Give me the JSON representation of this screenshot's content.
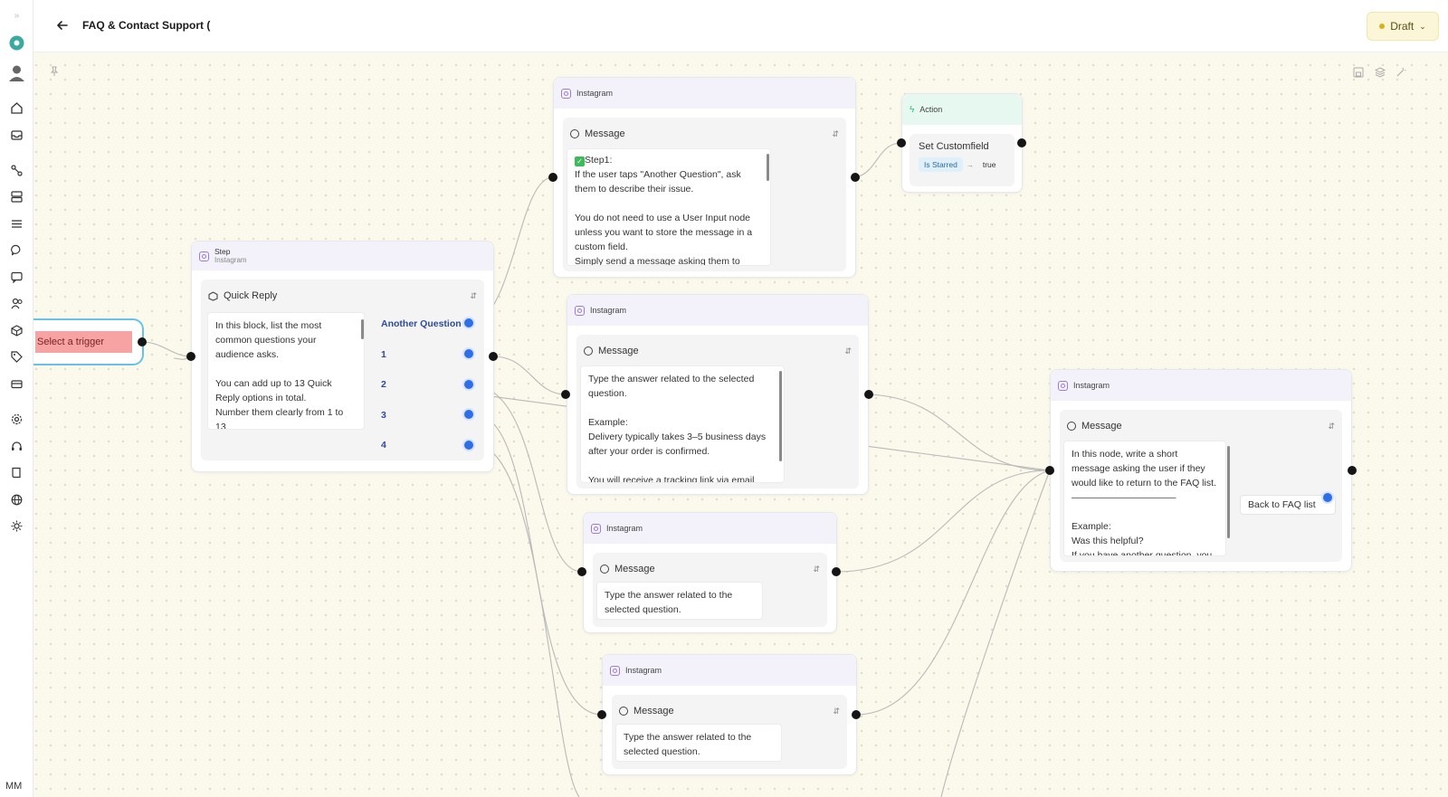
{
  "header": {
    "title": "FAQ & Contact Support (",
    "status": "Draft"
  },
  "sidebar": {
    "user_initials": "MM",
    "icons": [
      "collapse-icon",
      "workspace-icon",
      "profile-icon",
      "home-icon",
      "inbox-icon",
      "flows-icon",
      "templates-icon",
      "list-icon",
      "chat-icon",
      "comments-icon",
      "contacts-icon",
      "integrations-icon",
      "tags-icon",
      "billing-icon",
      "settings-icon",
      "support-icon",
      "docs-icon",
      "language-icon",
      "theme-icon"
    ]
  },
  "trigger": {
    "label": "Select a trigger"
  },
  "step_node": {
    "title": "Step",
    "subtitle": "Instagram",
    "block_label": "Quick Reply",
    "text": "In this block, list the most common questions your audience asks.\n\nYou can add up to 13 Quick Reply options in total.\nNumber them clearly from 1 to 13.",
    "options": [
      "Another Question",
      "1",
      "2",
      "3",
      "4"
    ]
  },
  "message_nodes": [
    {
      "platform": "Instagram",
      "label": "Message",
      "step_badge": "Step1:",
      "text": "If the user taps \"Another Question\", ask them to describe their issue.\n\nYou do not need to use a User Input node unless you want to store the message in a custom field.\nSimply send a message asking them to"
    },
    {
      "platform": "Instagram",
      "label": "Message",
      "text": "Type the answer related to the selected question.\n\nExample:\nDelivery typically takes 3–5 business days after your order is confirmed.\n\nYou will receive a tracking link via email"
    },
    {
      "platform": "Instagram",
      "label": "Message",
      "text": "Type the answer related to the selected question."
    },
    {
      "platform": "Instagram",
      "label": "Message",
      "text": "Type the answer related to the selected question."
    },
    {
      "platform": "Instagram",
      "label": "Message",
      "text": "In this node, write a short message asking the user if they would like to return to the FAQ list.\n———————————\n\nExample:\nWas this helpful?\nIf you have another question, you",
      "button_label": "Back to FAQ list"
    }
  ],
  "action_node": {
    "title": "Action",
    "action_label": "Set Customfield",
    "field": "Is Starred",
    "arrow": "→",
    "value": "true"
  },
  "colors": {
    "accent": "#2f6ee9",
    "trigger_bg": "#f7a3a3",
    "trigger_border": "#66c3e6",
    "draft_dot": "#d8b21e",
    "header_purple": "#f3f2fb",
    "action_green": "#e6f8ef"
  }
}
